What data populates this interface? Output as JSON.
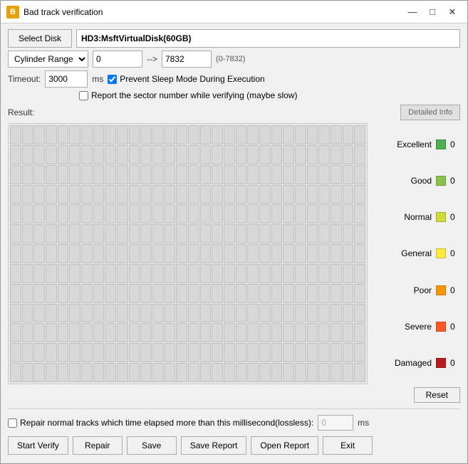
{
  "window": {
    "title": "Bad track verification",
    "icon_label": "B"
  },
  "toolbar": {
    "select_disk_label": "Select Disk",
    "disk_value": "HD3:MsftVirtualDisk(60GB)"
  },
  "cylinder_range": {
    "dropdown_label": "Cylinder Range",
    "from_value": "0",
    "arrow": "-->",
    "to_value": "7832",
    "range_hint": "(0-7832)"
  },
  "timeout": {
    "label": "Timeout:",
    "value": "3000",
    "unit": "ms"
  },
  "checkboxes": {
    "prevent_sleep": {
      "label": "Prevent Sleep Mode During Execution",
      "checked": true
    },
    "report_sector": {
      "label": "Report the sector number while verifying (maybe slow)",
      "checked": false
    }
  },
  "result": {
    "label": "Result:",
    "detailed_info_label": "Detailed Info"
  },
  "legend": {
    "items": [
      {
        "name": "Excellent",
        "color": "#4caf50",
        "count": "0"
      },
      {
        "name": "Good",
        "color": "#8bc34a",
        "count": "0"
      },
      {
        "name": "Normal",
        "color": "#cddc39",
        "count": "0"
      },
      {
        "name": "General",
        "color": "#ffeb3b",
        "count": "0"
      },
      {
        "name": "Poor",
        "color": "#ff9800",
        "count": "0"
      },
      {
        "name": "Severe",
        "color": "#ff5722",
        "count": "0"
      },
      {
        "name": "Damaged",
        "color": "#b71c1c",
        "count": "0"
      }
    ]
  },
  "reset_btn": "Reset",
  "repair_row": {
    "checkbox_label": "Repair normal tracks which time elapsed more than this millisecond(lossless):",
    "ms_value": "0",
    "ms_unit": "ms"
  },
  "bottom_buttons": [
    "Start Verify",
    "Repair",
    "Save",
    "Save Report",
    "Open Report",
    "Exit"
  ]
}
